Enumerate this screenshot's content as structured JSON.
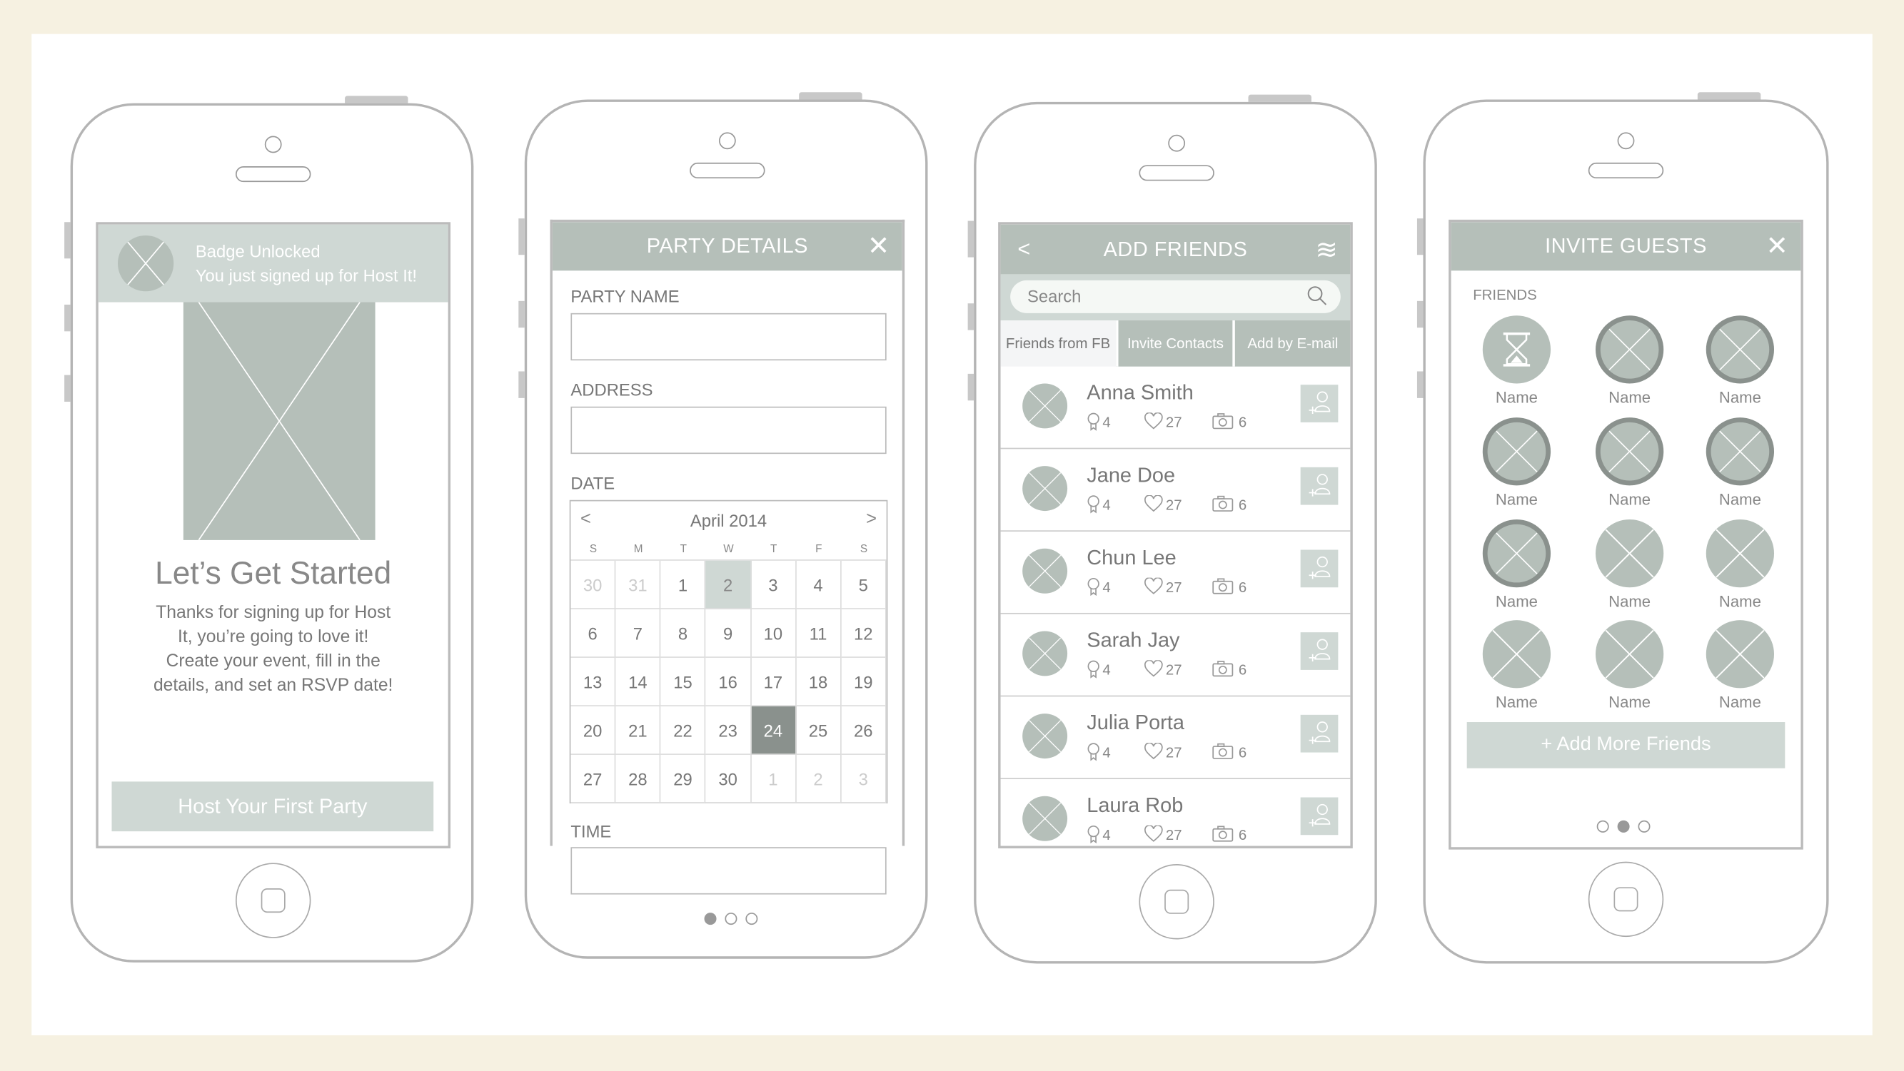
{
  "colors": {
    "background": "#f6f1e1",
    "header": "#b5bfb9",
    "light_accent": "#cfd8d4",
    "dark_accent": "#8a918d",
    "text": "#777777"
  },
  "screen1": {
    "badge_title": "Badge Unlocked",
    "badge_text": "You just signed up for Host It!",
    "heading": "Let’s Get Started",
    "body_lines": [
      "Thanks for signing up for Host",
      "It, you’re going to love it!",
      "Create your event, fill in the",
      "details, and set an RSVP date!"
    ],
    "cta": "Host Your First Party"
  },
  "screen2": {
    "title": "PARTY DETAILS",
    "close_icon": "close-icon",
    "party_name_label": "PARTY NAME",
    "party_name_value": "",
    "address_label": "ADDRESS",
    "address_value": "",
    "date_label": "DATE",
    "time_label": "TIME",
    "time_value": "",
    "calendar": {
      "month": "April 2014",
      "prev": "<",
      "next": ">",
      "weekdays": [
        "S",
        "M",
        "T",
        "W",
        "T",
        "F",
        "S"
      ],
      "days": [
        {
          "d": "30",
          "s": "mute"
        },
        {
          "d": "31",
          "s": "mute"
        },
        {
          "d": "1"
        },
        {
          "d": "2",
          "s": "sel"
        },
        {
          "d": "3"
        },
        {
          "d": "4"
        },
        {
          "d": "5"
        },
        {
          "d": "6"
        },
        {
          "d": "7"
        },
        {
          "d": "8"
        },
        {
          "d": "9"
        },
        {
          "d": "10"
        },
        {
          "d": "11"
        },
        {
          "d": "12"
        },
        {
          "d": "13"
        },
        {
          "d": "14"
        },
        {
          "d": "15"
        },
        {
          "d": "16"
        },
        {
          "d": "17"
        },
        {
          "d": "18"
        },
        {
          "d": "19"
        },
        {
          "d": "20"
        },
        {
          "d": "21"
        },
        {
          "d": "22"
        },
        {
          "d": "23"
        },
        {
          "d": "24",
          "s": "today"
        },
        {
          "d": "25"
        },
        {
          "d": "26"
        },
        {
          "d": "27"
        },
        {
          "d": "28"
        },
        {
          "d": "29"
        },
        {
          "d": "30"
        },
        {
          "d": "1",
          "s": "mute"
        },
        {
          "d": "2",
          "s": "mute"
        },
        {
          "d": "3",
          "s": "mute"
        }
      ]
    },
    "page": 1,
    "pages": 3
  },
  "screen3": {
    "title": "ADD FRIENDS",
    "back": "<",
    "menu": "≋",
    "search_placeholder": "Search",
    "tabs": [
      "Friends from FB",
      "Invite Contacts",
      "Add by E-mail"
    ],
    "active_tab": 0,
    "friends": [
      {
        "name": "Anna Smith",
        "badges": "4",
        "likes": "27",
        "photos": "6"
      },
      {
        "name": "Jane Doe",
        "badges": "4",
        "likes": "27",
        "photos": "6"
      },
      {
        "name": "Chun Lee",
        "badges": "4",
        "likes": "27",
        "photos": "6"
      },
      {
        "name": "Sarah Jay",
        "badges": "4",
        "likes": "27",
        "photos": "6"
      },
      {
        "name": "Julia Porta",
        "badges": "4",
        "likes": "27",
        "photos": "6"
      },
      {
        "name": "Laura Rob",
        "badges": "4",
        "likes": "27",
        "photos": "6"
      }
    ]
  },
  "screen4": {
    "title": "INVITE GUESTS",
    "section": "FRIENDS",
    "button": "+ Add More Friends",
    "page": 2,
    "pages": 3,
    "guests": [
      {
        "name": "Name",
        "state": "pending"
      },
      {
        "name": "Name",
        "state": "selected"
      },
      {
        "name": "Name",
        "state": "selected"
      },
      {
        "name": "Name",
        "state": "selected"
      },
      {
        "name": "Name",
        "state": "selected"
      },
      {
        "name": "Name",
        "state": "selected"
      },
      {
        "name": "Name",
        "state": "selected"
      },
      {
        "name": "Name",
        "state": "none"
      },
      {
        "name": "Name",
        "state": "none"
      },
      {
        "name": "Name",
        "state": "none"
      },
      {
        "name": "Name",
        "state": "none"
      },
      {
        "name": "Name",
        "state": "none"
      }
    ]
  }
}
